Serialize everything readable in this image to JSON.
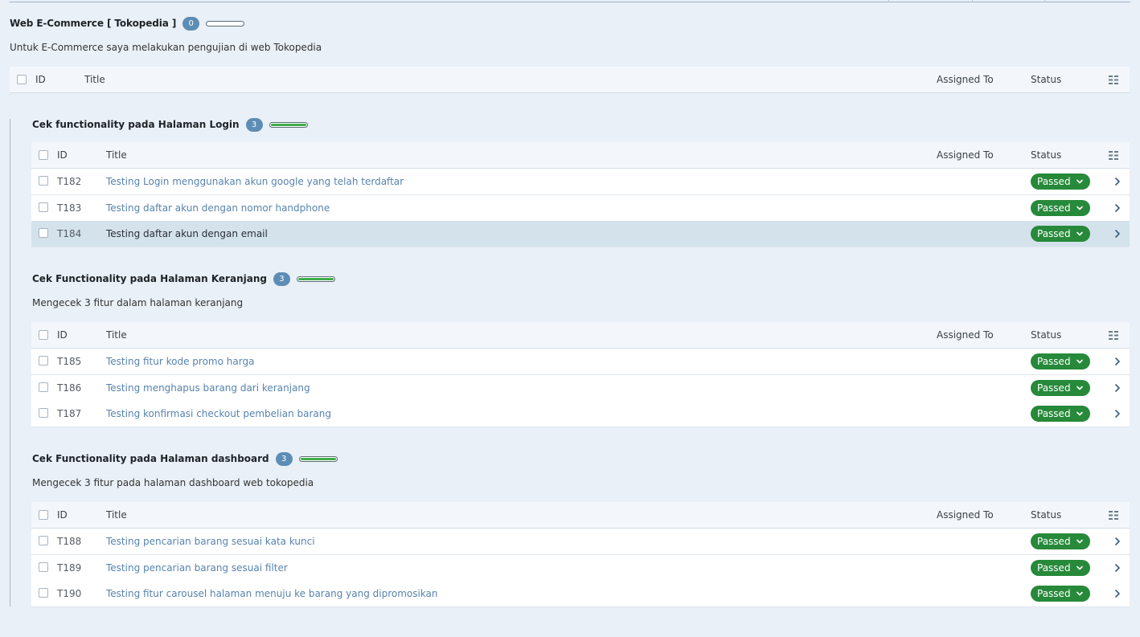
{
  "colors": {
    "background": "#e9f0f7",
    "badge": "#5d8db5",
    "status_passed": "#27893a",
    "progress_fill": "#3fae49",
    "link": "#5783ad"
  },
  "columns": {
    "id": "ID",
    "title": "Title",
    "assigned": "Assigned To",
    "status": "Status",
    "columns_icon": "column-settings-icon"
  },
  "root": {
    "title": "Web E-Commerce [ Tokopedia ]",
    "count": "0",
    "progress": 0,
    "description": "Untuk E-Commerce saya melakukan pengujian di web Tokopedia"
  },
  "sections": [
    {
      "title": "Cek functionality pada Halaman Login",
      "count": "3",
      "progress": 1.0,
      "description": "",
      "rows": [
        {
          "id": "T182",
          "title": "Testing Login menggunakan akun google yang telah terdaftar",
          "assigned": "",
          "status": "Passed"
        },
        {
          "id": "T183",
          "title": "Testing daftar akun dengan nomor handphone",
          "assigned": "",
          "status": "Passed"
        },
        {
          "id": "T184",
          "title": "Testing daftar akun dengan email",
          "assigned": "",
          "status": "Passed"
        }
      ]
    },
    {
      "title": "Cek Functionality pada Halaman Keranjang",
      "count": "3",
      "progress": 1.0,
      "description": "Mengecek 3 fitur dalam halaman keranjang",
      "rows": [
        {
          "id": "T185",
          "title": "Testing fitur kode promo harga",
          "assigned": "",
          "status": "Passed"
        },
        {
          "id": "T186",
          "title": "Testing menghapus barang dari keranjang",
          "assigned": "",
          "status": "Passed"
        },
        {
          "id": "T187",
          "title": "Testing konfirmasi checkout pembelian barang",
          "assigned": "",
          "status": "Passed"
        }
      ]
    },
    {
      "title": "Cek Functionality pada Halaman dashboard",
      "count": "3",
      "progress": 1.0,
      "description": "Mengecek 3 fitur pada halaman dashboard web tokopedia",
      "rows": [
        {
          "id": "T188",
          "title": "Testing pencarian barang sesuai kata kunci",
          "assigned": "",
          "status": "Passed"
        },
        {
          "id": "T189",
          "title": "Testing pencarian barang sesuai filter",
          "assigned": "",
          "status": "Passed"
        },
        {
          "id": "T190",
          "title": "Testing fitur carousel halaman menuju ke barang yang dipromosikan",
          "assigned": "",
          "status": "Passed"
        }
      ]
    }
  ]
}
